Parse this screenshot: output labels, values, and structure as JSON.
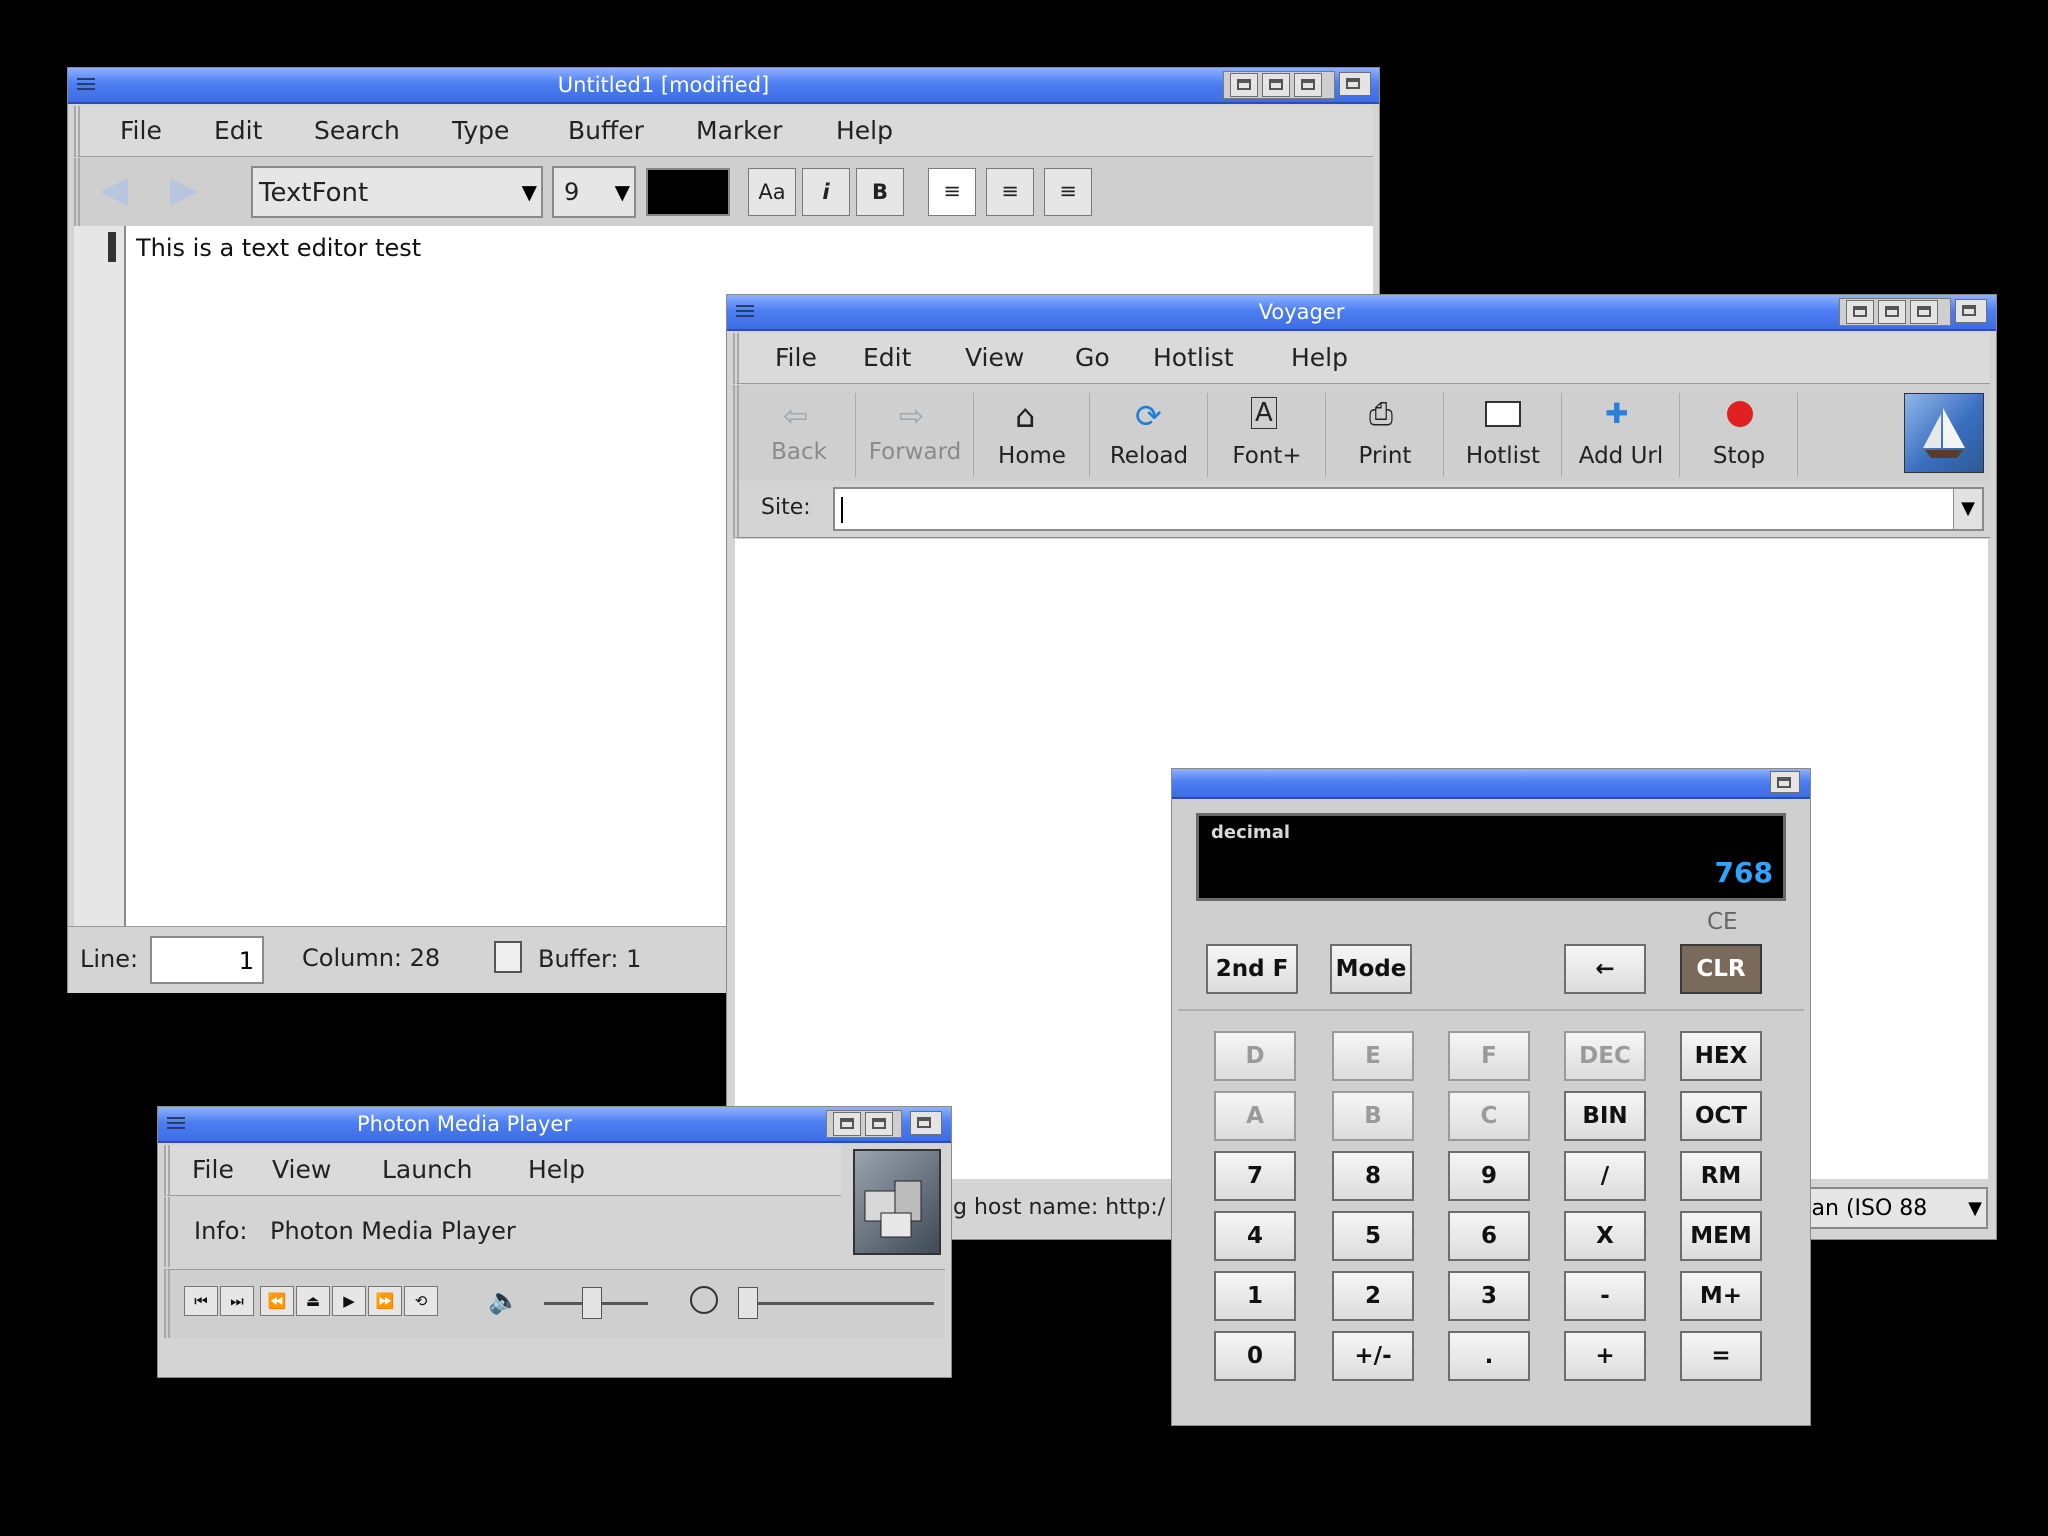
{
  "editor": {
    "title": "Untitled1 [modified]",
    "menus": [
      "File",
      "Edit",
      "Search",
      "Type",
      "Buffer",
      "Marker",
      "Help"
    ],
    "font_name": "TextFont",
    "font_size": "9",
    "style_buttons": [
      "Aa",
      "i",
      "B"
    ],
    "text": "This is a text editor test",
    "status": {
      "line_label": "Line:",
      "line_value": "1",
      "column": "Column: 28",
      "buffer": "Buffer: 1"
    }
  },
  "voyager": {
    "title": "Voyager",
    "menus": [
      "File",
      "Edit",
      "View",
      "Go",
      "Hotlist",
      "Help"
    ],
    "toolbar": [
      "Back",
      "Forward",
      "Home",
      "Reload",
      "Font+",
      "Print",
      "Hotlist",
      "Add Url",
      "Stop"
    ],
    "site_label": "Site:",
    "site_value": "",
    "status_text": "g host name: http:/",
    "encoding": "ean (ISO 88"
  },
  "calculator": {
    "display_mode": "decimal",
    "display_value": "768",
    "ce_label": "CE",
    "top_buttons": [
      "2nd F",
      "Mode",
      "←",
      "CLR"
    ],
    "rows": [
      [
        "D",
        "E",
        "F",
        "DEC",
        "HEX"
      ],
      [
        "A",
        "B",
        "C",
        "BIN",
        "OCT"
      ],
      [
        "7",
        "8",
        "9",
        "/",
        "RM"
      ],
      [
        "4",
        "5",
        "6",
        "X",
        "MEM"
      ],
      [
        "1",
        "2",
        "3",
        "-",
        "M+"
      ],
      [
        "0",
        "+/-",
        ".",
        "+",
        "="
      ]
    ]
  },
  "media_player": {
    "title": "Photon Media Player",
    "menus": [
      "File",
      "View",
      "Launch",
      "Help"
    ],
    "info_label": "Info:",
    "info_value": "Photon Media Player",
    "controls": [
      "⏮",
      "⏭",
      "⏪",
      "⏏",
      "▶",
      "⏩",
      "⟲"
    ]
  },
  "colors": {
    "title_blue": "#4d7ff2",
    "calc_value": "#2fa4ff",
    "clr_button": "#7a6a5c"
  }
}
